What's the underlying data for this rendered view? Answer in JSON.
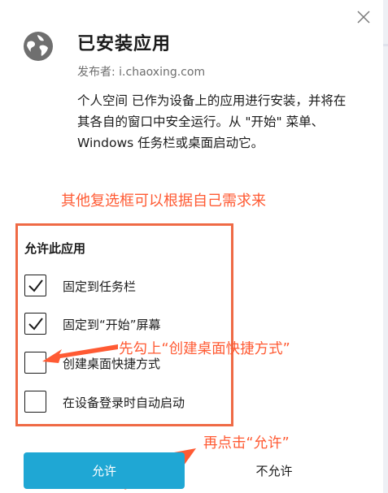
{
  "dialog": {
    "title": "已安装应用",
    "publisher": "发布者: i.chaoxing.com",
    "description": "个人空间 已作为设备上的应用进行安装，并将在其各自的窗口中安全运行。从 \"开始\" 菜单、Windows 任务栏或桌面启动它。",
    "icon": "globe-icon",
    "close_icon": "close-icon"
  },
  "permissions": {
    "title": "允许此应用",
    "options": [
      {
        "label": "固定到任务栏",
        "checked": true
      },
      {
        "label": "固定到“开始”屏幕",
        "checked": true
      },
      {
        "label": "创建桌面快捷方式",
        "checked": false
      },
      {
        "label": "在设备登录时自动启动",
        "checked": false
      }
    ]
  },
  "buttons": {
    "allow": "允许",
    "deny": "不允许"
  },
  "annotations": {
    "top": "其他复选框可以根据自己需求来",
    "middle": "先勾上“创建桌面快捷方式”",
    "bottom": "再点击“允许”"
  },
  "colors": {
    "accent": "#1fa7d4",
    "annotation": "#ff5a33"
  }
}
